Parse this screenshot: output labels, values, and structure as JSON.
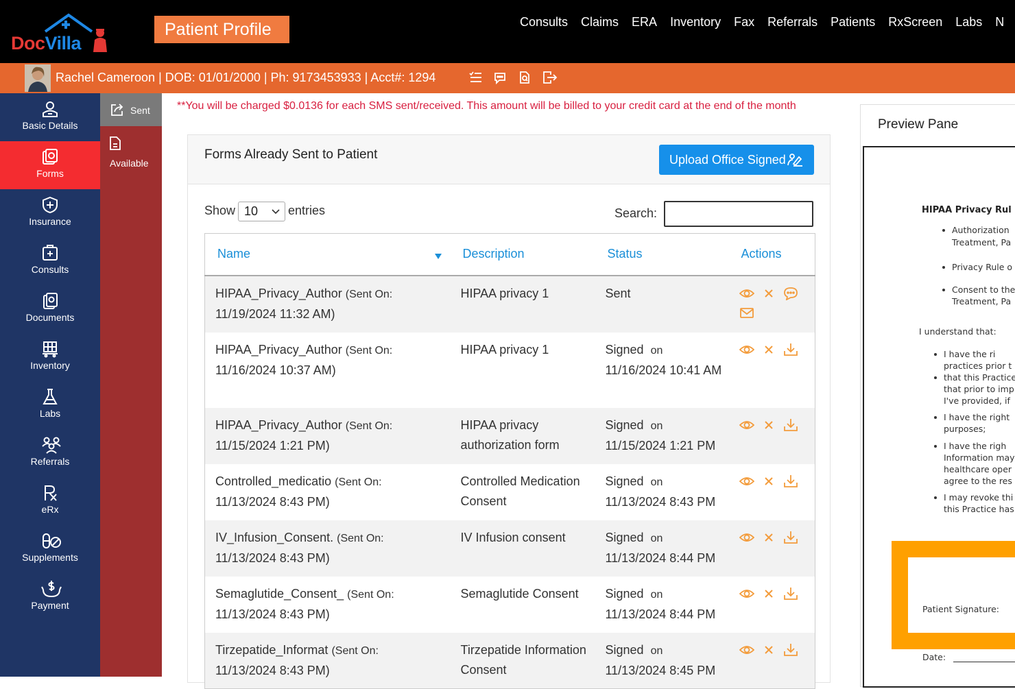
{
  "app": {
    "logo_doc": "Doc",
    "logo_villa": "Villa",
    "page_button": "Patient Profile",
    "nav": [
      "Consults",
      "Claims",
      "ERA",
      "Inventory",
      "Fax",
      "Referrals",
      "Patients",
      "RxScreen",
      "Labs",
      "N"
    ]
  },
  "patient": {
    "info": "Rachel Cameroon | DOB: 01/01/2000 | Ph: 9173453933 | Acct#: 1294",
    "icons": [
      "list-icon",
      "chat-icon",
      "document-search-icon",
      "logout-icon"
    ]
  },
  "sidebar": {
    "items": [
      {
        "label": "Basic Details",
        "icon": "user-icon"
      },
      {
        "label": "Forms",
        "icon": "forms-icon"
      },
      {
        "label": "Insurance",
        "icon": "shield-icon"
      },
      {
        "label": "Consults",
        "icon": "consult-icon"
      },
      {
        "label": "Documents",
        "icon": "documents-icon"
      },
      {
        "label": "Inventory",
        "icon": "inventory-icon"
      },
      {
        "label": "Labs",
        "icon": "flask-icon"
      },
      {
        "label": "Referrals",
        "icon": "referrals-icon"
      },
      {
        "label": "eRx",
        "icon": "rx-icon"
      },
      {
        "label": "Supplements",
        "icon": "supplements-icon"
      },
      {
        "label": "Payment",
        "icon": "payment-icon"
      }
    ],
    "active": "Forms"
  },
  "subnav": {
    "sent": "Sent",
    "available": "Available"
  },
  "notice": "**You will be charged $0.0136 for each SMS sent/received. This amount will be billed to your credit card at the end of the month",
  "forms_card": {
    "title": "Forms Already Sent to Patient",
    "upload_button": "Upload Office Signed",
    "show_label": "Show",
    "entries_value": "10",
    "entries_label": "entries",
    "search_label": "Search:",
    "search_value": "",
    "columns": [
      "Name",
      "Description",
      "Status",
      "Actions"
    ],
    "rows": [
      {
        "name": "HIPAA_Privacy_Author",
        "sent_on": "(Sent On:",
        "date": "11/19/2024 11:32 AM)",
        "description": "HIPAA privacy 1",
        "status": "Sent",
        "status_on": "",
        "status_date": "",
        "actions": [
          "eye-icon",
          "close-icon",
          "chat-icon",
          "envelope-icon"
        ]
      },
      {
        "name": "HIPAA_Privacy_Author",
        "sent_on": "(Sent On:",
        "date": "11/16/2024 10:37 AM)",
        "description": "HIPAA privacy 1",
        "status": "Signed",
        "status_on": "on",
        "status_date": "11/16/2024 10:41 AM",
        "actions": [
          "eye-icon",
          "close-icon",
          "download-icon"
        ]
      },
      {
        "name": "HIPAA_Privacy_Author",
        "sent_on": "(Sent On:",
        "date": "11/15/2024 1:21 PM)",
        "description": "HIPAA privacy authorization form",
        "status": "Signed",
        "status_on": "on",
        "status_date": "11/15/2024 1:21 PM",
        "actions": [
          "eye-icon",
          "close-icon",
          "download-icon"
        ]
      },
      {
        "name": "Controlled_medicatio",
        "sent_on": "(Sent On:",
        "date": "11/13/2024 8:43 PM)",
        "description": "Controlled Medication Consent",
        "status": "Signed",
        "status_on": "on",
        "status_date": "11/13/2024 8:43 PM",
        "actions": [
          "eye-icon",
          "close-icon",
          "download-icon"
        ]
      },
      {
        "name": "IV_Infusion_Consent.",
        "sent_on": "(Sent On:",
        "date": "11/13/2024 8:43 PM)",
        "description": "IV Infusion consent",
        "status": "Signed",
        "status_on": "on",
        "status_date": "11/13/2024 8:44 PM",
        "actions": [
          "eye-icon",
          "close-icon",
          "download-icon"
        ]
      },
      {
        "name": "Semaglutide_Consent_",
        "sent_on": "(Sent On:",
        "date": "11/13/2024 8:43 PM)",
        "description": "Semaglutide Consent",
        "status": "Signed",
        "status_on": "on",
        "status_date": "11/13/2024 8:44 PM",
        "actions": [
          "eye-icon",
          "close-icon",
          "download-icon"
        ]
      },
      {
        "name": "Tirzepatide_Informat",
        "sent_on": "(Sent On:",
        "date": "11/13/2024 8:43 PM)",
        "description": "Tirzepatide Information Consent",
        "status": "Signed",
        "status_on": "on",
        "status_date": "11/13/2024 8:45 PM",
        "actions": [
          "eye-icon",
          "close-icon",
          "download-icon"
        ]
      }
    ]
  },
  "preview": {
    "title": "Preview Pane",
    "doc_title": "HIPAA Privacy Rul",
    "lines": [
      "Authorization",
      "Treatment, Pa",
      "Privacy Rule o",
      "Consent to the",
      "Treatment, Pa",
      "I understand that:",
      "I  have  the  ri",
      "practices prior t",
      "that this Practice",
      "that prior to imp",
      "I've provided, if",
      "I have the right",
      "purposes;",
      "I  have  the  righ",
      "Information may",
      "healthcare oper",
      "agree to the res",
      "I may revoke thi",
      "this Practice has"
    ],
    "signature_label": "Patient Signature:",
    "date_label": "Date:"
  },
  "colors": {
    "topbar": "#000000",
    "accent_orange": "#e5672e",
    "sidebar": "#1f3565",
    "active": "#f42c30",
    "subbar": "#9e2f2f",
    "link_blue": "#1a8fd8",
    "action_orange": "#f39c3c"
  }
}
